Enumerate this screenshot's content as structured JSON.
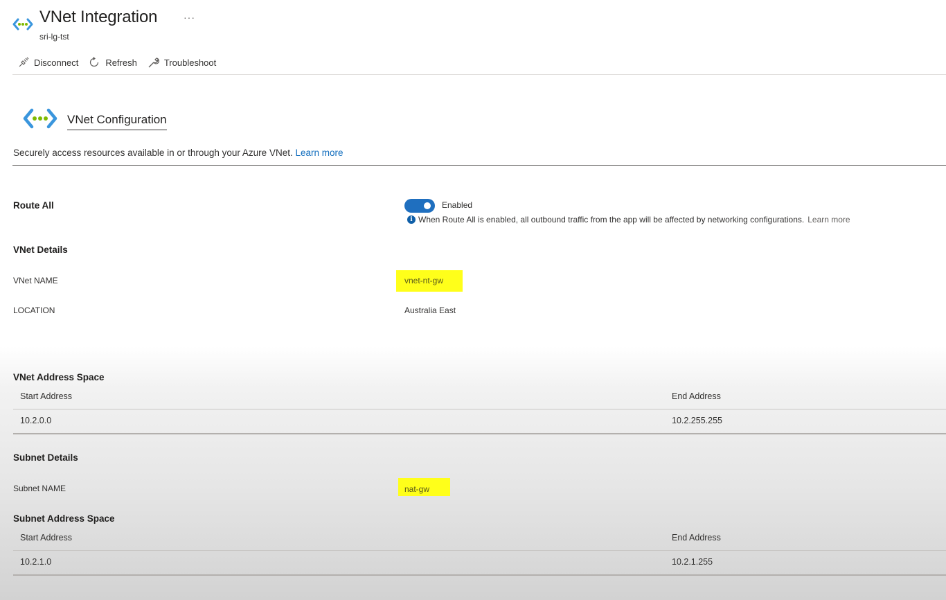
{
  "header": {
    "title": "VNet Integration",
    "more": "···",
    "subtitle": "sri-lg-tst"
  },
  "toolbar": {
    "disconnect": "Disconnect",
    "refresh": "Refresh",
    "troubleshoot": "Troubleshoot"
  },
  "config": {
    "title": "VNet Configuration",
    "description": "Securely access resources available in or through your Azure VNet.",
    "learn_more": "Learn more"
  },
  "route_all": {
    "label": "Route All",
    "state": "Enabled",
    "info": "When Route All is enabled, all outbound traffic from the app will be affected by networking configurations.",
    "learn_more": "Learn more"
  },
  "vnet_details": {
    "heading": "VNet Details",
    "name_label": "VNet NAME",
    "name_value": "vnet-nt-gw",
    "location_label": "LOCATION",
    "location_value": "Australia East"
  },
  "vnet_address_space": {
    "heading": "VNet Address Space",
    "columns": [
      "Start Address",
      "End Address"
    ],
    "rows": [
      [
        "10.2.0.0",
        "10.2.255.255"
      ]
    ]
  },
  "subnet_details": {
    "heading": "Subnet Details",
    "name_label": "Subnet NAME",
    "name_value": "nat-gw"
  },
  "subnet_address_space": {
    "heading": "Subnet Address Space",
    "columns": [
      "Start Address",
      "End Address"
    ],
    "rows": [
      [
        "10.2.1.0",
        "10.2.1.255"
      ]
    ]
  },
  "colors": {
    "accent": "#0f6cbd",
    "toggle": "#1f6fbf",
    "highlight": "#ffff1a",
    "icon_blue": "#3a96dd",
    "icon_green": "#7fba00"
  },
  "icons": [
    "vnet-icon",
    "more-icon",
    "disconnect-icon",
    "refresh-icon",
    "troubleshoot-icon",
    "info-icon"
  ]
}
